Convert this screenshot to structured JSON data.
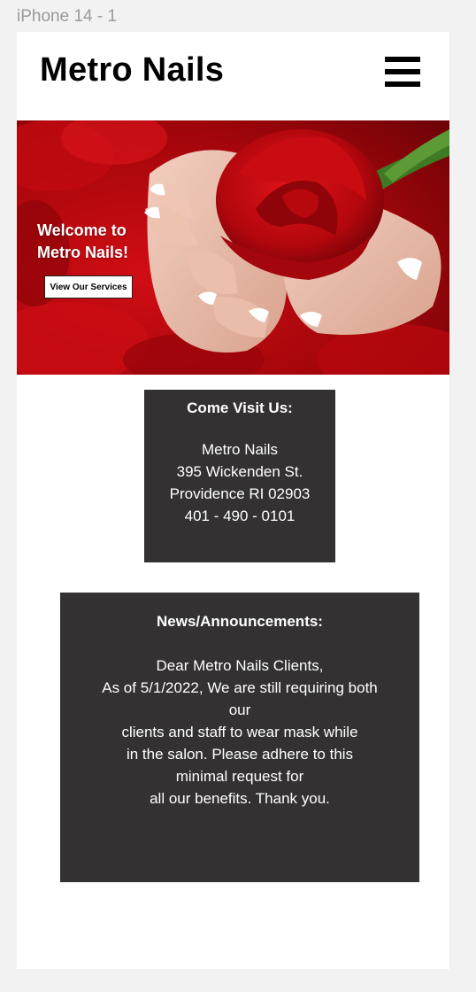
{
  "frame": {
    "label": "iPhone 14 - 1"
  },
  "header": {
    "logo": "Metro Nails",
    "menu_icon": "hamburger-menu-icon"
  },
  "hero": {
    "title": "Welcome to\nMetro Nails!",
    "button_label": "View Our Services",
    "image": "hands-holding-red-rose"
  },
  "visit": {
    "title": "Come Visit Us:",
    "lines": [
      "Metro Nails",
      "395 Wickenden St.",
      "Providence RI 02903",
      "401 - 490 - 0101"
    ]
  },
  "news": {
    "title": "News/Announcements:",
    "lines": [
      "Dear Metro Nails Clients,",
      "As of 5/1/2022, We are still requiring both",
      "our",
      "clients and staff to wear mask while",
      "in the salon. Please adhere to this",
      "minimal request for",
      "all our benefits. Thank you."
    ]
  },
  "colors": {
    "box_background": "#333132",
    "hero_red": "#b3060c"
  }
}
